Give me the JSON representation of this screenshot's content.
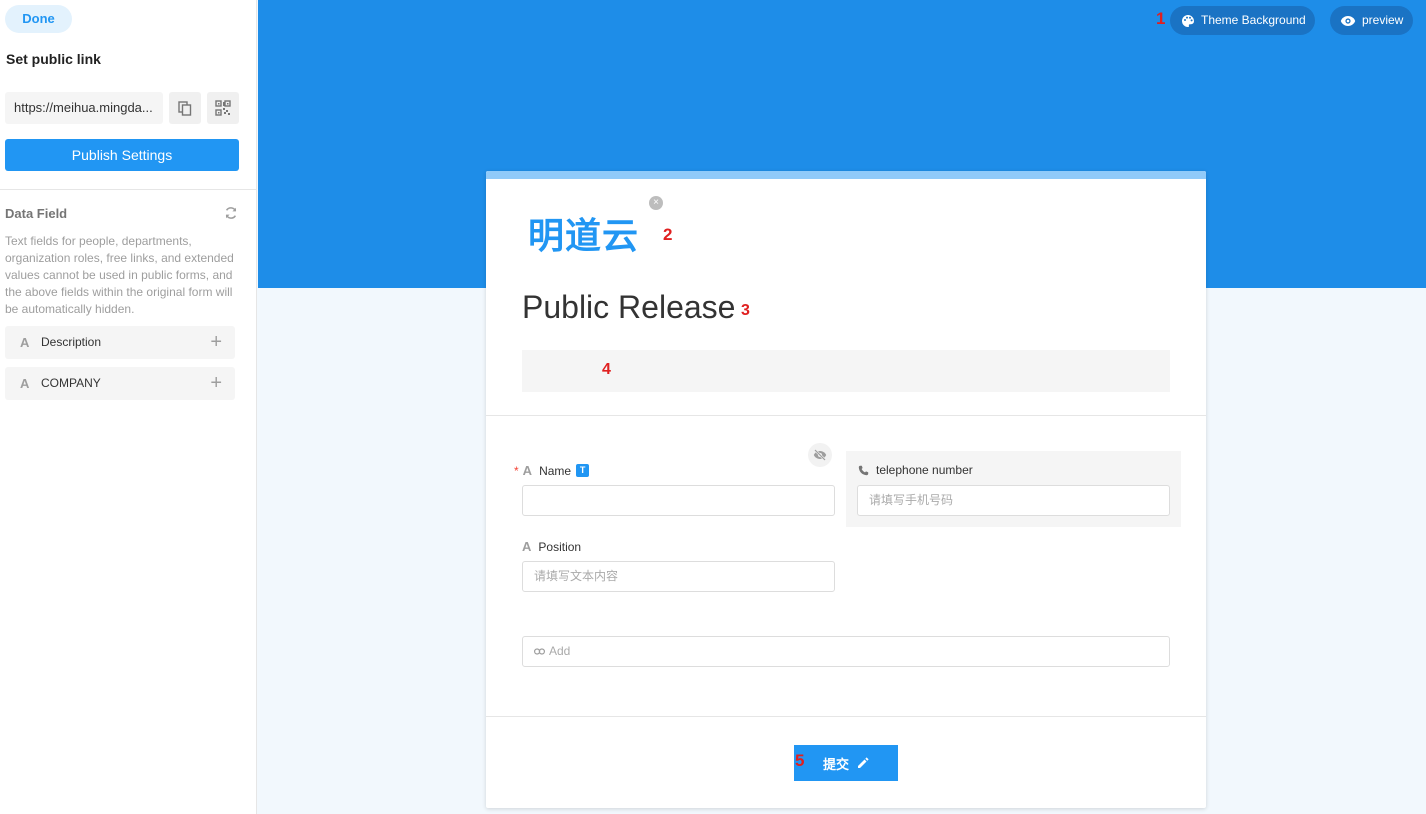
{
  "sidebar": {
    "done_label": "Done",
    "section_title": "Set public link",
    "public_link": "https://meihua.mingda...",
    "publish_label": "Publish Settings",
    "data_field_title": "Data Field",
    "data_field_desc": "Text fields for people, departments, organization roles, free links, and extended values cannot be used in public forms, and the above fields within the original form will be automatically hidden.",
    "fields": [
      {
        "icon": "A",
        "label": "Description",
        "plus": "+"
      },
      {
        "icon": "A",
        "label": "COMPANY",
        "plus": "+"
      }
    ]
  },
  "header": {
    "theme_label": "Theme Background",
    "preview_label": "preview"
  },
  "markers": [
    "1",
    "2",
    "3",
    "4",
    "5"
  ],
  "form": {
    "logo_text": "明道云",
    "logo_close": "×",
    "title": "Public Release",
    "name_field": {
      "required": "*",
      "icon": "A",
      "label": "Name",
      "badge": "T"
    },
    "tel_field": {
      "label": "telephone number",
      "placeholder": "请填写手机号码"
    },
    "position_field": {
      "icon": "A",
      "label": "Position",
      "placeholder": "请填写文本内容"
    },
    "add_placeholder": "Add",
    "submit_label": "提交"
  },
  "colors": {
    "accent": "#2196f3",
    "banner": "#1e8de8",
    "marker": "#e02020"
  }
}
